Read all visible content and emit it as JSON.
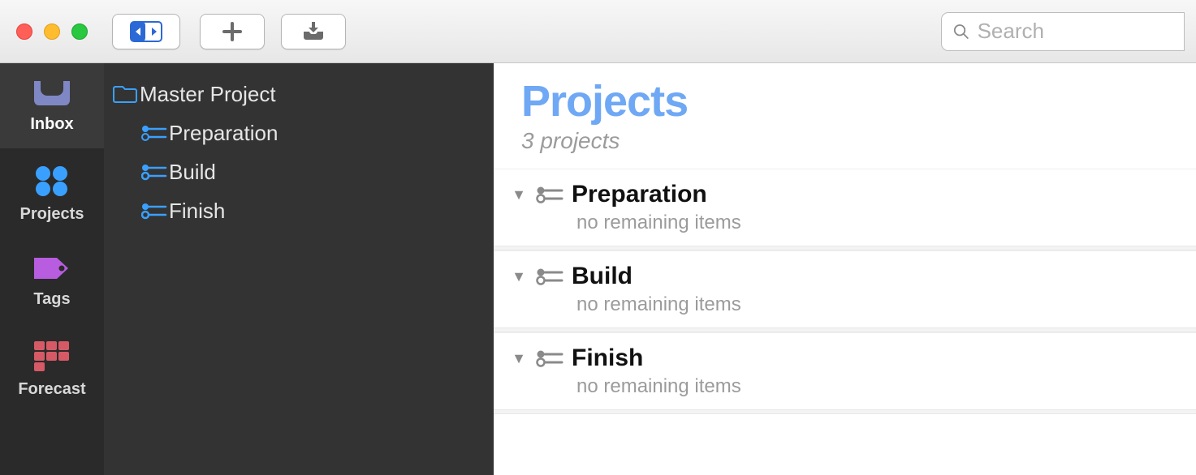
{
  "toolbar": {
    "search_placeholder": "Search"
  },
  "rail": {
    "items": [
      {
        "key": "inbox",
        "label": "Inbox",
        "color": "#7f88c5"
      },
      {
        "key": "projects",
        "label": "Projects",
        "color": "#3aa0ff"
      },
      {
        "key": "tags",
        "label": "Tags",
        "color": "#b85ce0"
      },
      {
        "key": "forecast",
        "label": "Forecast",
        "color": "#d65a66"
      }
    ],
    "selected": "inbox"
  },
  "outline": {
    "root_label": "Master Project",
    "children": [
      {
        "label": "Preparation"
      },
      {
        "label": "Build"
      },
      {
        "label": "Finish"
      }
    ]
  },
  "main": {
    "title": "Projects",
    "subtitle": "3 projects",
    "projects": [
      {
        "name": "Preparation",
        "status": "no remaining items"
      },
      {
        "name": "Build",
        "status": "no remaining items"
      },
      {
        "name": "Finish",
        "status": "no remaining items"
      }
    ]
  },
  "colors": {
    "accent_blue": "#6fa8f4",
    "outline_icon": "#3aa0ff"
  }
}
